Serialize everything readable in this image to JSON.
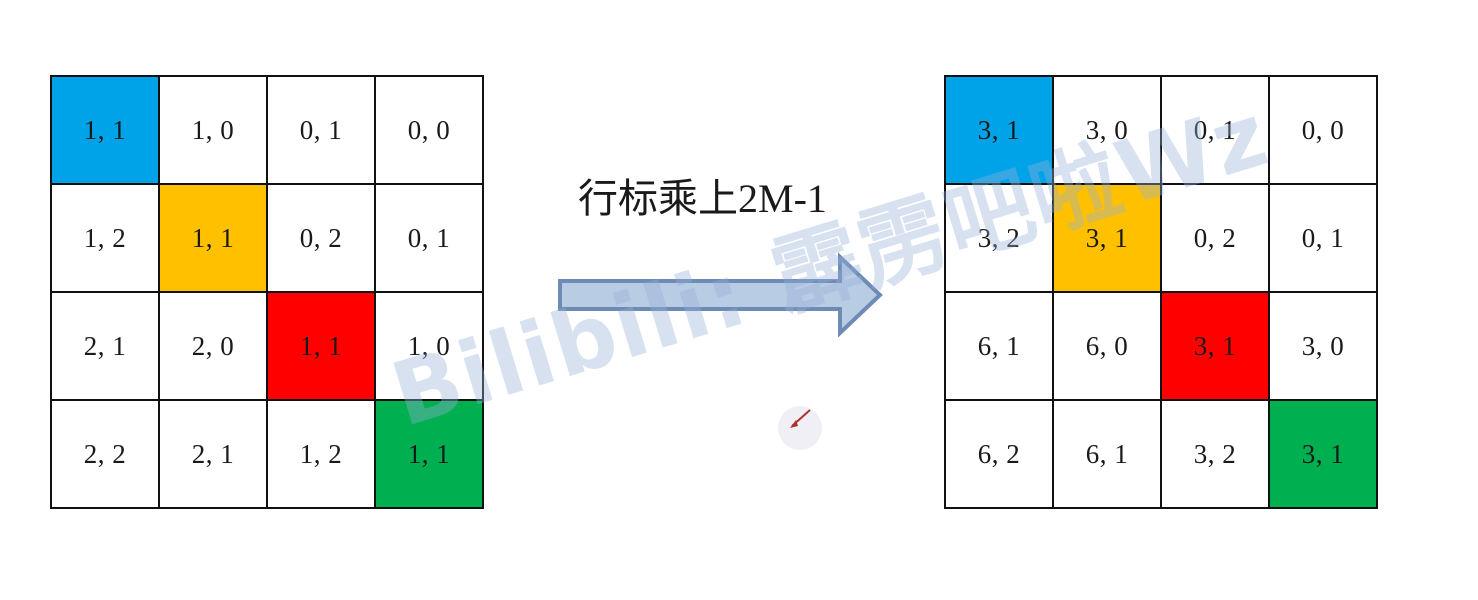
{
  "left_matrix": {
    "rows": [
      [
        "1, 1",
        "1, 0",
        "0, 1",
        "0, 0"
      ],
      [
        "1, 2",
        "1, 1",
        "0, 2",
        "0, 1"
      ],
      [
        "2, 1",
        "2, 0",
        "1, 1",
        "1, 0"
      ],
      [
        "2, 2",
        "2, 1",
        "1, 2",
        "1, 1"
      ]
    ]
  },
  "right_matrix": {
    "rows": [
      [
        "3, 1",
        "3, 0",
        "0, 1",
        "0, 0"
      ],
      [
        "3, 2",
        "3, 1",
        "0, 2",
        "0, 1"
      ],
      [
        "6, 1",
        "6, 0",
        "3, 1",
        "3, 0"
      ],
      [
        "6, 2",
        "6, 1",
        "3, 2",
        "3, 1"
      ]
    ]
  },
  "caption": {
    "cjk": "行标乘上",
    "latin": "2M-1"
  },
  "watermark": "Bilibili: 霹雳吧啦Wz",
  "colors": {
    "diagonal_0": "#00A3E8",
    "diagonal_1": "#FFC000",
    "diagonal_2": "#FF0000",
    "diagonal_3": "#00B050",
    "arrow_fill": "#B8CCE4",
    "arrow_stroke": "#6E8BB5",
    "grid_border": "#111111"
  }
}
